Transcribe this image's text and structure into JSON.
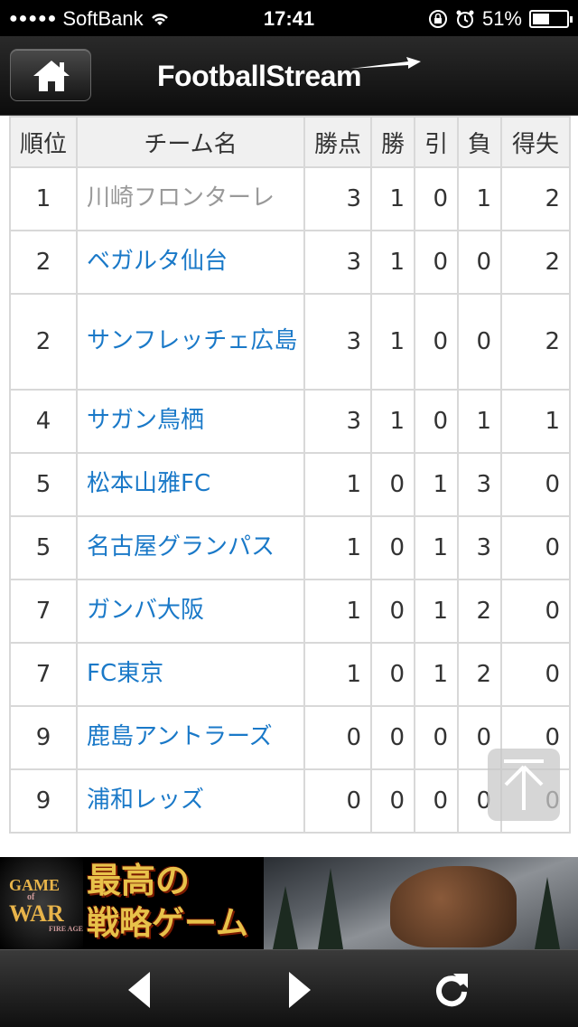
{
  "status_bar": {
    "signal_dots": "●●●●●",
    "carrier": "SoftBank",
    "time": "17:41",
    "battery_text": "51%",
    "battery_level": 0.51
  },
  "header": {
    "logo_text": "FootballStream",
    "home_icon": "home-icon"
  },
  "table": {
    "headers": [
      "順位",
      "チーム名",
      "勝点",
      "勝",
      "引",
      "負",
      "得失"
    ],
    "rows": [
      {
        "rank": "1",
        "team": "川崎フロンターレ",
        "pts": "3",
        "w": "1",
        "d": "0",
        "l": "1",
        "gd": "2"
      },
      {
        "rank": "2",
        "team": "ベガルタ仙台",
        "pts": "3",
        "w": "1",
        "d": "0",
        "l": "0",
        "gd": "2"
      },
      {
        "rank": "2",
        "team": "サンフレッチェ広島",
        "pts": "3",
        "w": "1",
        "d": "0",
        "l": "0",
        "gd": "2"
      },
      {
        "rank": "4",
        "team": "サガン鳥栖",
        "pts": "3",
        "w": "1",
        "d": "0",
        "l": "1",
        "gd": "1"
      },
      {
        "rank": "5",
        "team": "松本山雅FC",
        "pts": "1",
        "w": "0",
        "d": "1",
        "l": "3",
        "gd": "0"
      },
      {
        "rank": "5",
        "team": "名古屋グランパス",
        "pts": "1",
        "w": "0",
        "d": "1",
        "l": "3",
        "gd": "0"
      },
      {
        "rank": "7",
        "team": "ガンバ大阪",
        "pts": "1",
        "w": "0",
        "d": "1",
        "l": "2",
        "gd": "0"
      },
      {
        "rank": "7",
        "team": "FC東京",
        "pts": "1",
        "w": "0",
        "d": "1",
        "l": "2",
        "gd": "0"
      },
      {
        "rank": "9",
        "team": "鹿島アントラーズ",
        "pts": "0",
        "w": "0",
        "d": "0",
        "l": "0",
        "gd": "0"
      },
      {
        "rank": "9",
        "team": "浦和レッズ",
        "pts": "0",
        "w": "0",
        "d": "0",
        "l": "0",
        "gd": "0"
      }
    ]
  },
  "ad": {
    "brand_line1": "GAME",
    "brand_line2": "of",
    "brand_line3": "WAR",
    "brand_line4": "FIRE AGE",
    "headline_line1": "最高の",
    "headline_line2": "戦略ゲーム"
  },
  "toolbar": {
    "back_icon": "back-arrow-icon",
    "forward_icon": "forward-arrow-icon",
    "reload_icon": "reload-icon"
  },
  "colors": {
    "team_link": "#1a79c8",
    "team_link_muted": "#999999",
    "header_bg": "#0c0c0c",
    "table_border": "#d8d8d8"
  }
}
